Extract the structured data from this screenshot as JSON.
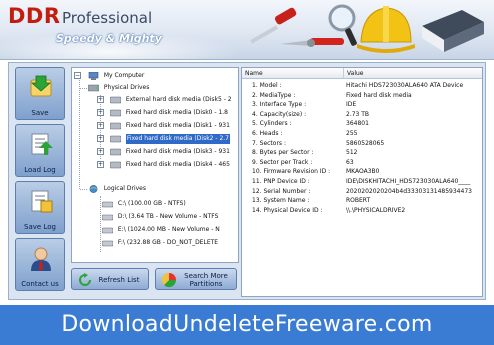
{
  "header": {
    "brand": "DDR",
    "edition": "Professional",
    "tagline": "Speedy & Mighty",
    "artwork_icons": [
      "screwdriver-icon",
      "pliers-icon",
      "magnifier-icon",
      "hard-hat-icon",
      "book-icon"
    ]
  },
  "left_toolbar": [
    {
      "label": "Save",
      "icon": "save-icon"
    },
    {
      "label": "Load Log",
      "icon": "load-log-icon"
    },
    {
      "label": "Save Log",
      "icon": "save-log-icon"
    },
    {
      "label": "Contact us",
      "icon": "contact-us-icon"
    }
  ],
  "tree": {
    "root": "My Computer",
    "physical_drives": {
      "label": "Physical Drives",
      "items": [
        "External hard disk media (Disk5 - 2",
        "Fixed hard disk media (Disk0 - 1.8",
        "Fixed hard disk media (Disk1 - 931",
        "Fixed hard disk media (Disk2 - 2.7",
        "Fixed hard disk media (Disk3 - 931",
        "Fixed hard disk media (Disk4 - 465"
      ],
      "selected_index": 3
    },
    "logical_drives": {
      "label": "Logical Drives",
      "items": [
        "C:\\ (100.00 GB  -  NTFS)",
        "D:\\ (3.64 TB - New Volume - NTFS",
        "E:\\ (1024.00 MB - New Volume - N",
        "F:\\ (232.88 GB - DO_NOT_DELETE"
      ]
    }
  },
  "table": {
    "columns": [
      "Name",
      "Value"
    ],
    "rows": [
      [
        "1. Model :",
        "Hitachi HDS723030ALA640 ATA Device"
      ],
      [
        "2. MediaType :",
        "Fixed hard disk media"
      ],
      [
        "3. Interface Type :",
        "IDE"
      ],
      [
        "4. Capacity(size) :",
        "2.73 TB"
      ],
      [
        "5. Cylinders :",
        "364801"
      ],
      [
        "6. Heads :",
        "255"
      ],
      [
        "7. Sectors :",
        "5860528065"
      ],
      [
        "8. Bytes per Sector :",
        "512"
      ],
      [
        "9. Sector per Track :",
        "63"
      ],
      [
        "10. Firmware Revision ID :",
        "MKAOA3B0"
      ],
      [
        "11. PNP Device ID :",
        "IDE\\DISKHITACHI_HDS723030ALA640____"
      ],
      [
        "12. Serial Number :",
        "2020202020204b4d33303131485934473"
      ],
      [
        "13. System Name :",
        "ROBERT"
      ],
      [
        "14. Physical Device ID :",
        "\\\\.\\PHYSICALDRIVE2"
      ]
    ]
  },
  "buttons": {
    "refresh": "Refresh List",
    "search_line1": "Search More",
    "search_line2": "Partitions"
  },
  "footer": {
    "text": "DownloadUndeleteFreeware.com"
  },
  "colors": {
    "brand_red": "#c21e10",
    "footer_blue": "#3a7bd3",
    "selection_blue": "#2f6ac9",
    "panel_bg": "#dbe4f1"
  }
}
